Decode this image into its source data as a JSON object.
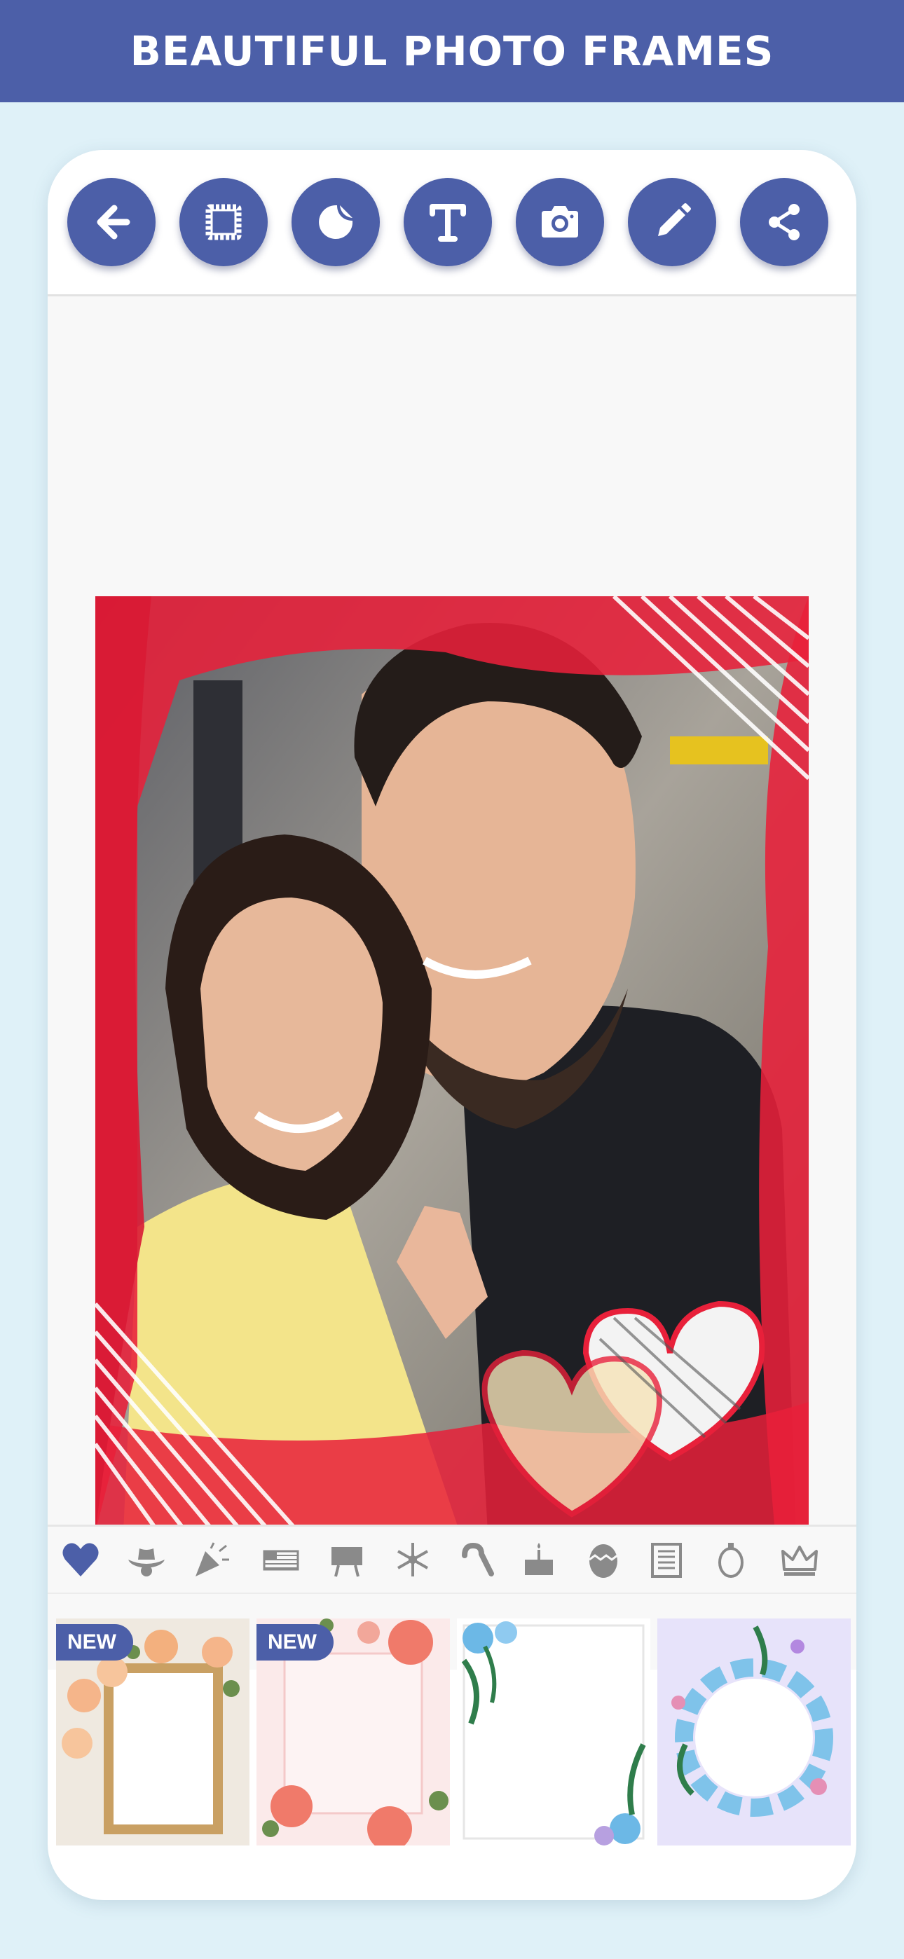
{
  "banner": {
    "title": "BEAUTIFUL PHOTO FRAMES"
  },
  "colors": {
    "accent": "#4c5fa8",
    "background": "#dff1f8",
    "frame_red": "#e8203a"
  },
  "toolbar": {
    "buttons": [
      {
        "name": "back",
        "icon": "arrow-left-icon"
      },
      {
        "name": "frame",
        "icon": "frame-icon"
      },
      {
        "name": "sticker",
        "icon": "sticker-icon"
      },
      {
        "name": "text",
        "icon": "text-icon"
      },
      {
        "name": "camera",
        "icon": "camera-icon"
      },
      {
        "name": "edit",
        "icon": "pencil-icon"
      },
      {
        "name": "share",
        "icon": "share-icon"
      }
    ]
  },
  "categories": [
    {
      "icon": "heart-icon",
      "selected": true
    },
    {
      "icon": "cowboy-hat-icon"
    },
    {
      "icon": "party-popper-icon"
    },
    {
      "icon": "flag-icon"
    },
    {
      "icon": "billboard-icon"
    },
    {
      "icon": "snowflake-icon"
    },
    {
      "icon": "candy-cane-icon"
    },
    {
      "icon": "cake-icon"
    },
    {
      "icon": "easter-egg-icon"
    },
    {
      "icon": "newspaper-icon"
    },
    {
      "icon": "ornament-icon"
    },
    {
      "icon": "crown-icon"
    }
  ],
  "frames": [
    {
      "badge": "NEW",
      "style": "roses-wood-frame"
    },
    {
      "badge": "NEW",
      "style": "pink-floral-frame"
    },
    {
      "badge": "",
      "style": "blue-floral-corners"
    },
    {
      "badge": "",
      "style": "floral-wreath-circle"
    }
  ]
}
